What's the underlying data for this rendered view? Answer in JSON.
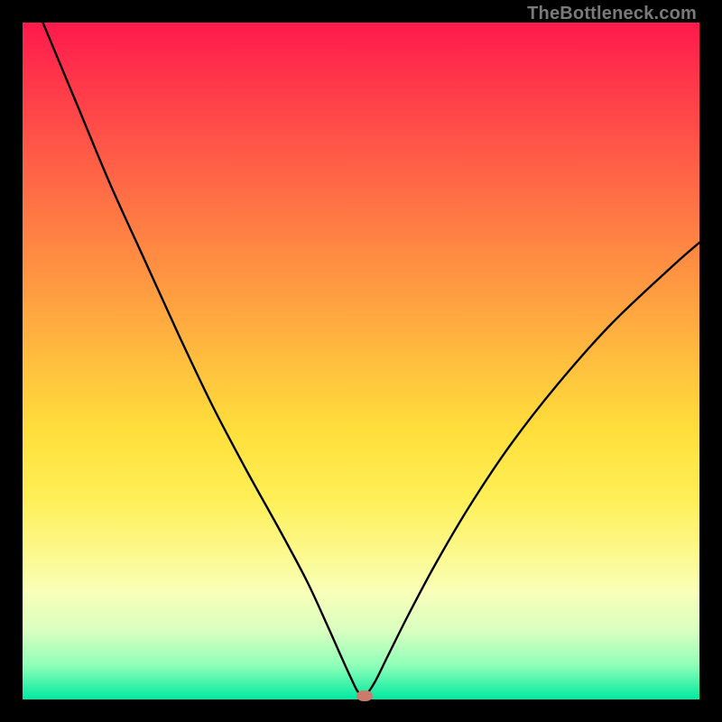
{
  "watermark": "TheBottleneck.com",
  "chart_data": {
    "type": "line",
    "title": "",
    "xlabel": "",
    "ylabel": "",
    "xlim": [
      0,
      100
    ],
    "ylim": [
      0,
      100
    ],
    "series": [
      {
        "name": "bottleneck-curve",
        "x": [
          3,
          8,
          13,
          18,
          23,
          28,
          33,
          38,
          42,
          45,
          47,
          48.5,
          49.5,
          50.5,
          52,
          54,
          57,
          61,
          66,
          72,
          79,
          87,
          96,
          100
        ],
        "values": [
          100,
          88,
          76,
          65,
          54,
          43.5,
          34,
          25,
          17.5,
          11,
          6.5,
          3.2,
          1.2,
          0.5,
          2.5,
          6.5,
          12.5,
          20,
          28.5,
          37.5,
          46.5,
          55.5,
          64,
          67.5
        ]
      }
    ],
    "annotations": [
      {
        "name": "optimum-marker",
        "x": 50.5,
        "y": 0.5,
        "color": "#cc7a6b"
      }
    ],
    "background_gradient": {
      "top": "#ff1a4d",
      "mid": "#ffde3b",
      "bottom": "#00e8a0"
    }
  }
}
